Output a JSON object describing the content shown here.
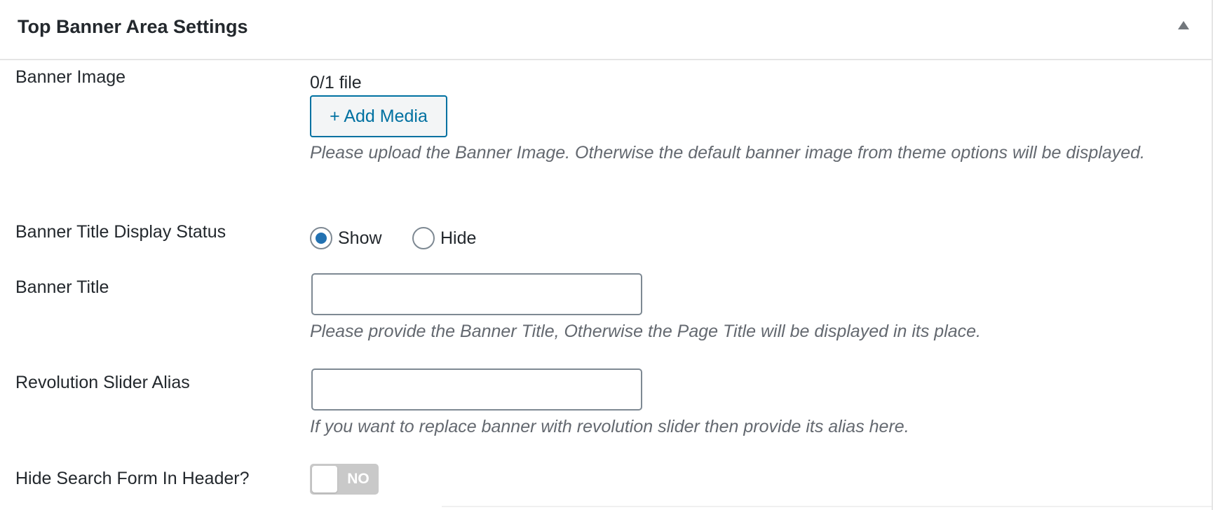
{
  "panel": {
    "title": "Top Banner Area Settings",
    "toggle_icon": "triangle-up-icon"
  },
  "banner_image": {
    "label": "Banner Image",
    "file_count": "0/1 file",
    "add_media_label": "+ Add Media",
    "description": "Please upload the Banner Image. Otherwise the default banner image from theme options will be displayed."
  },
  "banner_title_display": {
    "label": "Banner Title Display Status",
    "options": [
      {
        "label": "Show",
        "checked": true
      },
      {
        "label": "Hide",
        "checked": false
      }
    ]
  },
  "banner_title": {
    "label": "Banner Title",
    "value": "",
    "description": "Please provide the Banner Title, Otherwise the Page Title will be displayed in its place."
  },
  "revolution_slider": {
    "label": "Revolution Slider Alias",
    "value": "",
    "description": "If you want to replace banner with revolution slider then provide its alias here."
  },
  "hide_search": {
    "label": "Hide Search Form In Header?",
    "switch_text": "NO",
    "enabled": false
  },
  "colors": {
    "accent": "#0071a1",
    "radio_checked": "#2271b1",
    "switch_off": "#c9c9c9"
  }
}
